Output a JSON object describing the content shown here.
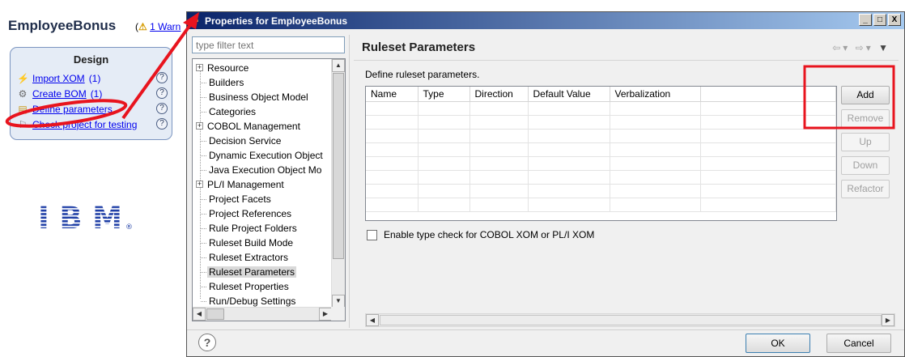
{
  "editor": {
    "title": "EmployeeBonus",
    "warning_link": "1 Warn",
    "design": {
      "header": "Design",
      "items": [
        {
          "label": "Import XOM",
          "count": "(1)"
        },
        {
          "label": "Create BOM",
          "count": "(1)"
        },
        {
          "label": "Define parameters",
          "count": ""
        },
        {
          "label": "Check project for testing",
          "count": ""
        }
      ],
      "help_glyph": "?"
    },
    "logo_text": "IBM"
  },
  "dialog": {
    "title": "Properties for EmployeeBonus",
    "window_buttons": [
      "_",
      "□",
      "X"
    ],
    "filter_placeholder": "type filter text",
    "tree": [
      {
        "label": "Resource",
        "expandable": true
      },
      {
        "label": "Builders"
      },
      {
        "label": "Business Object Model"
      },
      {
        "label": "Categories"
      },
      {
        "label": "COBOL Management",
        "expandable": true
      },
      {
        "label": "Decision Service"
      },
      {
        "label": "Dynamic Execution Object"
      },
      {
        "label": "Java Execution Object Mo"
      },
      {
        "label": "PL/I Management",
        "expandable": true
      },
      {
        "label": "Project Facets"
      },
      {
        "label": "Project References"
      },
      {
        "label": "Rule Project Folders"
      },
      {
        "label": "Ruleset Build Mode"
      },
      {
        "label": "Ruleset Extractors"
      },
      {
        "label": "Ruleset Parameters",
        "selected": true
      },
      {
        "label": "Ruleset Properties"
      },
      {
        "label": "Run/Debug Settings"
      }
    ],
    "page": {
      "title": "Ruleset Parameters",
      "description": "Define ruleset parameters.",
      "columns": [
        "Name",
        "Type",
        "Direction",
        "Default Value",
        "Verbalization",
        ""
      ],
      "rows": 8,
      "buttons": [
        {
          "label": "Add",
          "enabled": true
        },
        {
          "label": "Remove",
          "enabled": false
        },
        {
          "label": "Up",
          "enabled": false
        },
        {
          "label": "Down",
          "enabled": false
        },
        {
          "label": "Refactor",
          "enabled": false
        }
      ],
      "checkbox_label": "Enable type check for COBOL XOM or PL/I XOM",
      "checkbox_checked": false
    },
    "footer": {
      "help_glyph": "?",
      "ok_label": "OK",
      "cancel_label": "Cancel"
    }
  },
  "colors": {
    "annotation_red": "#e8141e",
    "title_gradient_start": "#0a246a",
    "link": "#0000ee",
    "ibm_blue": "#1f3fa6"
  }
}
